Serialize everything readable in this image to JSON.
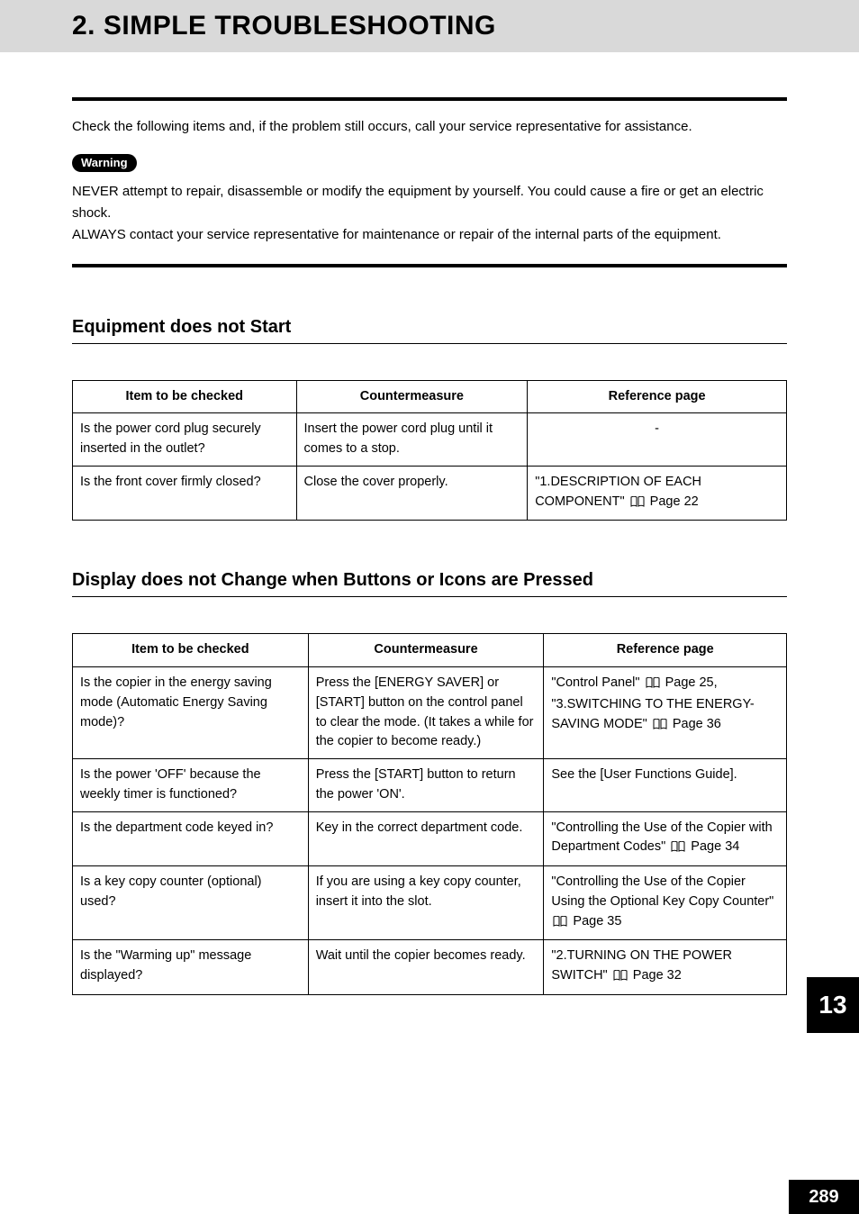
{
  "header": {
    "title": "2. SIMPLE TROUBLESHOOTING"
  },
  "intro": {
    "lead": "Check the following items and, if the problem still occurs, call your service representative for assistance.",
    "warning_label": "Warning",
    "warn_line1": "NEVER attempt to repair, disassemble or modify the equipment by yourself. You could cause a fire or get an electric shock.",
    "warn_line2": "ALWAYS contact your service representative for maintenance or repair of the internal parts of the equipment."
  },
  "section1": {
    "heading": "Equipment does not Start",
    "columns": {
      "c1": "Item to be checked",
      "c2": "Countermeasure",
      "c3": "Reference page"
    },
    "rows": [
      {
        "item": "Is the power cord plug securely inserted in the outlet?",
        "counter": "Insert the power cord plug until it comes to a stop.",
        "ref": "-",
        "ref_is_dash": true
      },
      {
        "item": "Is the front cover firmly closed?",
        "counter": "Close the cover properly.",
        "ref_prefix": "\"1.DESCRIPTION OF EACH COMPONENT\"",
        "ref_page": " Page 22"
      }
    ]
  },
  "section2": {
    "heading": "Display does not Change when Buttons or Icons are Pressed",
    "columns": {
      "c1": "Item to be checked",
      "c2": "Countermeasure",
      "c3": "Reference page"
    },
    "rows": [
      {
        "item": "Is the copier in the energy saving mode (Automatic Energy Saving mode)?",
        "counter": "Press the [ENERGY SAVER] or [START] button on the control panel to clear the mode. (It takes a while for the copier to become ready.)",
        "ref_parts": [
          {
            "text": "\"Control Panel\"",
            "page": " Page 25, "
          },
          {
            "text": "\"3.SWITCHING TO THE ENERGY-SAVING MODE\"",
            "page": " Page 36"
          }
        ]
      },
      {
        "item": "Is the power 'OFF' because the weekly timer is functioned?",
        "counter": "Press the [START] button to return the power 'ON'.",
        "ref_plain": "See the [User Functions Guide]."
      },
      {
        "item": "Is the department code keyed in?",
        "counter": "Key in the correct department code.",
        "ref_parts": [
          {
            "text": "\"Controlling the Use of the Copier with Department Codes\"",
            "page": " Page 34"
          }
        ]
      },
      {
        "item": "Is a key copy counter (optional) used?",
        "counter": "If you are using a key copy counter, insert it into the slot.",
        "ref_parts": [
          {
            "text": "\"Controlling the Use of the Copier Using the Optional Key Copy Counter\"",
            "page": " Page 35"
          }
        ]
      },
      {
        "item": "Is the \"Warming up\" message displayed?",
        "counter": "Wait until the copier becomes ready.",
        "ref_parts": [
          {
            "text": "\"2.TURNING ON THE POWER SWITCH\"",
            "page": " Page 32"
          }
        ]
      }
    ]
  },
  "side_tab": "13",
  "page_number": "289"
}
